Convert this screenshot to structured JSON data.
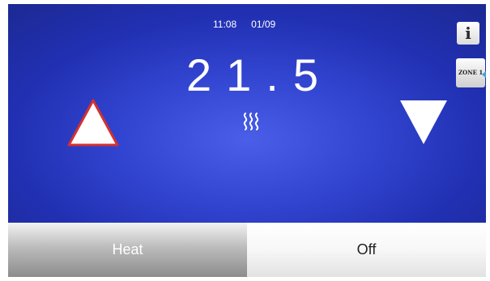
{
  "status": {
    "time": "11:08",
    "date": "01/09"
  },
  "setpoint": {
    "value": "21.5"
  },
  "buttons": {
    "info_label": "i",
    "zone_label": "ZONE 1"
  },
  "modes": {
    "heat_label": "Heat",
    "off_label": "Off"
  },
  "colors": {
    "background": "#2a3bc4",
    "up_arrow_border": "#d43030",
    "zone_indicator": "#3aa0e0"
  },
  "icons": {
    "up": "increase-temperature-icon",
    "down": "decrease-temperature-icon",
    "heating": "heating-waves-icon"
  }
}
